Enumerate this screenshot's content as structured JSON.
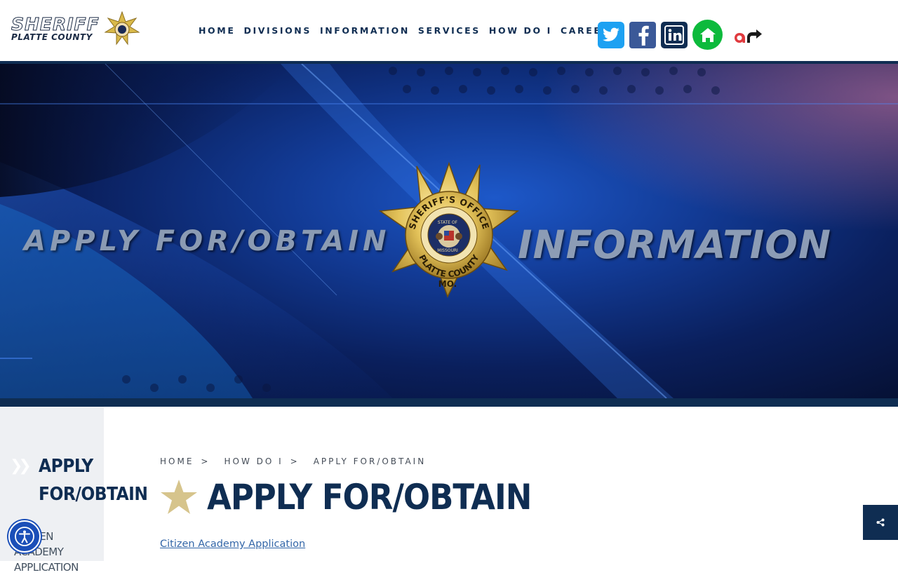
{
  "logo": {
    "line1": "SHERIFF",
    "line2": "PLATTE COUNTY"
  },
  "nav": {
    "items": [
      "HOME",
      "DIVISIONS",
      "INFORMATION",
      "SERVICES",
      "HOW DO I",
      "CAREERS"
    ]
  },
  "social": {
    "icons": [
      "twitter-icon",
      "facebook-icon",
      "linkedin-icon",
      "nextdoor-icon",
      "alertreach-icon"
    ],
    "colors": {
      "twitter": "#1da1f2",
      "facebook": "#3b5998",
      "linkedin": "#0f2d52",
      "nextdoor": "#0dba3c",
      "ar": "#e03a3e"
    }
  },
  "banner": {
    "left_text": "APPLY FOR/OBTAIN",
    "right_text": "INFORMATION",
    "badge": {
      "top_text": "SHERIFF'S OFFICE",
      "bottom_text": "PLATTE COUNTY",
      "state": "MO.",
      "seal_top": "STATE OF",
      "seal_bottom": "MISSOURI"
    }
  },
  "sidebar": {
    "title": "APPLY FOR/OBTAIN",
    "item": "CITIZEN ACADEMY APPLICATION"
  },
  "breadcrumb": [
    "HOME",
    "HOW DO I",
    "APPLY FOR/OBTAIN"
  ],
  "breadcrumb_sep": ">",
  "page_title": "APPLY FOR/OBTAIN",
  "content": {
    "link": "Citizen Academy Application"
  },
  "colors": {
    "navy": "#0f2d52",
    "gold": "#d6c48c",
    "link": "#3366a8"
  }
}
